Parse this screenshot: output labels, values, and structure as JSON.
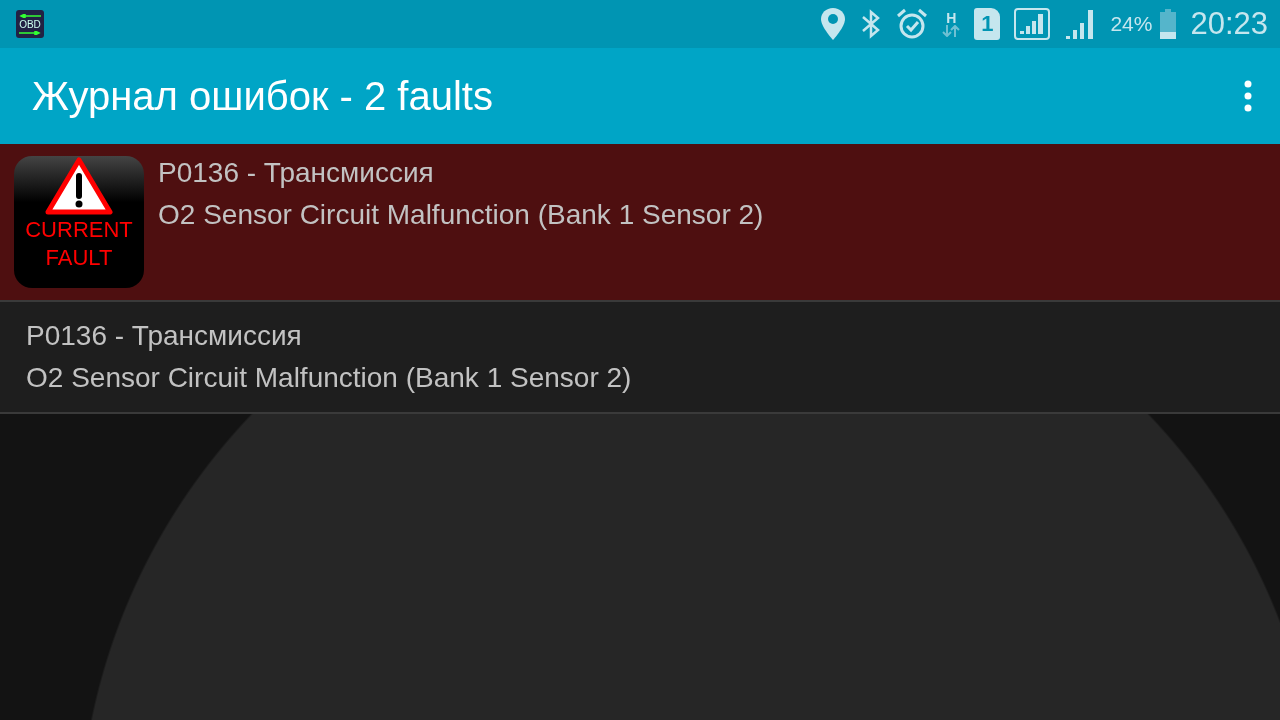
{
  "status_bar": {
    "notification_icon_label": "OBD",
    "network_type": "H",
    "sim_slot": "1",
    "battery_percent": "24%",
    "time": "20:23"
  },
  "app_bar": {
    "title": "Журнал ошибок - 2 faults"
  },
  "faults": [
    {
      "kind": "current",
      "badge_lines": [
        "CURRENT",
        "FAULT"
      ],
      "code": "P0136 - Трансмиссия",
      "description": "O2 Sensor Circuit Malfunction (Bank 1 Sensor 2)"
    },
    {
      "kind": "stored",
      "code": "P0136 - Трансмиссия",
      "description": "O2 Sensor Circuit Malfunction (Bank 1 Sensor 2)"
    }
  ]
}
